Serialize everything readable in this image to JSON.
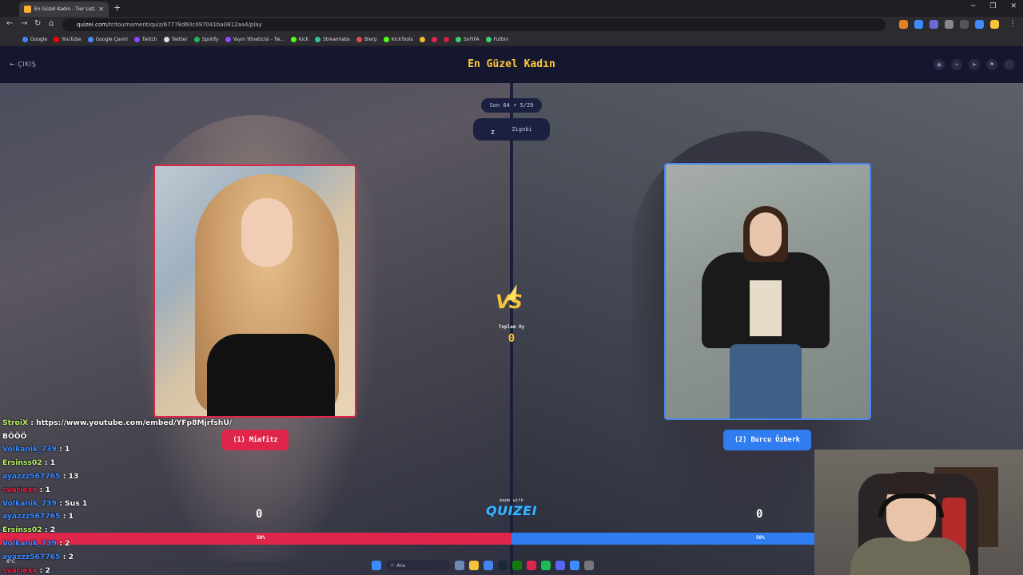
{
  "browser": {
    "tab_title": "En Güzel Kadın - Tier List, Kör S",
    "url_host": "quizei.com",
    "url_path": "/tr/tournament/quiz/67778d60c097041ba0812aa4/play",
    "bookmarks": [
      {
        "label": "Google",
        "color": "#4285f4"
      },
      {
        "label": "YouTube",
        "color": "#ff0000"
      },
      {
        "label": "Google Çeviri",
        "color": "#4a8af4"
      },
      {
        "label": "Twitch",
        "color": "#9146ff"
      },
      {
        "label": "Twitter",
        "color": "#dddddd"
      },
      {
        "label": "Spotify",
        "color": "#1db954"
      },
      {
        "label": "Yayın Yöneticisi - Tw...",
        "color": "#9146ff"
      },
      {
        "label": "Kick",
        "color": "#53fc18"
      },
      {
        "label": "Streamlabs",
        "color": "#31c3a2"
      },
      {
        "label": "Blerp",
        "color": "#e04a4a"
      },
      {
        "label": "KickTools",
        "color": "#53fc18"
      },
      {
        "label": "",
        "color": "#f3ba2f"
      },
      {
        "label": "",
        "color": "#e0254a"
      },
      {
        "label": "",
        "color": "#cc2244"
      },
      {
        "label": "SoFIFA",
        "color": "#3ecf6e"
      },
      {
        "label": "Futbin",
        "color": "#3ecf6e"
      }
    ]
  },
  "header": {
    "exit_label": "← ÇIKIŞ",
    "title": "En Güzel Kadın",
    "icons": [
      "eye-icon",
      "link-icon",
      "send-icon",
      "flag-icon",
      "fullscreen-icon"
    ]
  },
  "round": {
    "label": "Son 64 • 5/29",
    "creator_initial": "Z",
    "creator_name": "Zigobi"
  },
  "left": {
    "name": "(1) Miafitz",
    "votes": "0",
    "percent": "50%",
    "color": "#e0254a"
  },
  "right": {
    "name": "(2) Burcu Özberk",
    "votes": "0",
    "percent": "50%",
    "color": "#2f7df0"
  },
  "center": {
    "vs": "VS",
    "total_label": "Toplam Oy",
    "total_value": "0",
    "made_with": "made with",
    "logo": "QUIZEI"
  },
  "chat": [
    {
      "user": "StroiX",
      "color": "#b7f06a",
      "text": "https://www.youtube.com/embed/YFp8MjrfshU/"
    },
    {
      "user": "",
      "color": "#ffffff",
      "text": "BÖÖÖ"
    },
    {
      "user": "Volkanik_739",
      "color": "#3d8bff",
      "text": "1"
    },
    {
      "user": "Ersinss02",
      "color": "#b7f06a",
      "text": "1"
    },
    {
      "user": "ayazzz567765",
      "color": "#3d8bff",
      "text": "13"
    },
    {
      "user": "svariexx",
      "color": "#e0254a",
      "text": "1"
    },
    {
      "user": "Volkanik_739",
      "color": "#3d8bff",
      "text": "Sus 1"
    },
    {
      "user": "ayazzz567765",
      "color": "#3d8bff",
      "text": "1"
    },
    {
      "user": "Ersinss02",
      "color": "#b7f06a",
      "text": "2"
    },
    {
      "user": "Volkanik_739",
      "color": "#3d8bff",
      "text": "2"
    },
    {
      "user": "ayazzz567765",
      "color": "#3d8bff",
      "text": "2"
    },
    {
      "user": "svariexx",
      "color": "#e0254a",
      "text": "2"
    }
  ],
  "taskbar": {
    "search_label": "Ara",
    "weather": "6°C"
  }
}
